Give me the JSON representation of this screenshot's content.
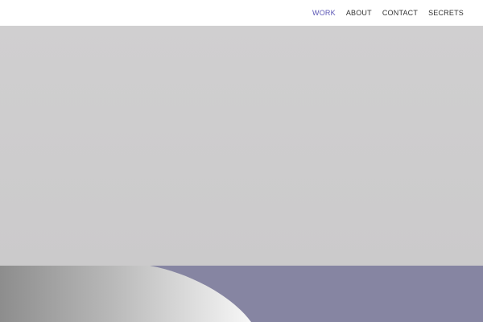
{
  "nav": {
    "items": [
      {
        "label": "WORK",
        "active": true
      },
      {
        "label": "ABOUT",
        "active": false
      },
      {
        "label": "CONTACT",
        "active": false
      },
      {
        "label": "SECRETS",
        "active": false
      }
    ]
  },
  "colors": {
    "accent": "#5b56b5",
    "nav_text": "#333333",
    "hero_bg": "#cfcecf",
    "panel_purple": "#8685a2"
  }
}
